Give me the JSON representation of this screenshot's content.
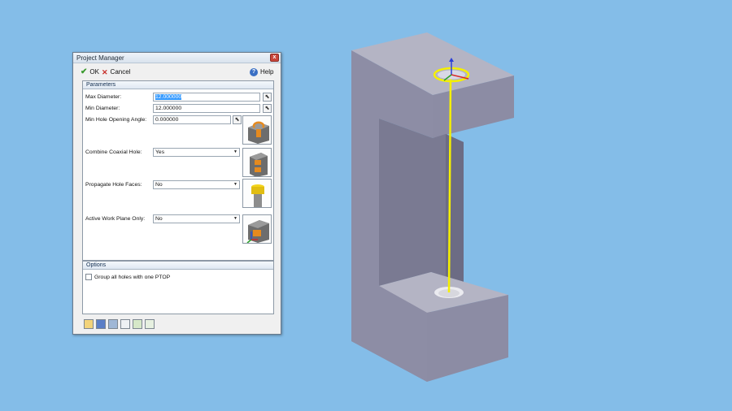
{
  "window": {
    "title": "Project Manager",
    "close_glyph": "x"
  },
  "toolbar": {
    "ok_label": "OK",
    "cancel_label": "Cancel",
    "help_label": "Help"
  },
  "parameters": {
    "header": "Parameters",
    "max_diameter": {
      "label": "Max Diameter:",
      "value": "12.000000"
    },
    "min_diameter": {
      "label": "Min Diameter:",
      "value": "12.000000"
    },
    "min_hole_opening_angle": {
      "label": "Min Hole Opening Angle:",
      "value": "0.000000"
    },
    "combine_coaxial_hole": {
      "label": "Combine Coaxial Hole:",
      "value": "Yes"
    },
    "propagate_hole_faces": {
      "label": "Propagate Hole Faces:",
      "value": "No"
    },
    "active_work_plane_only": {
      "label": "Active Work Plane Only:",
      "value": "No"
    }
  },
  "options": {
    "header": "Options",
    "group_all_holes": "Group all holes with one PTOP"
  },
  "icons": {
    "ok": "check-icon",
    "cancel": "x-icon",
    "help": "help-icon",
    "pick": "pick-icon",
    "preview_angle": "hole-opening-angle-preview",
    "preview_coaxial": "coaxial-hole-preview",
    "preview_propagate": "propagate-faces-preview",
    "preview_workplane": "work-plane-preview"
  },
  "colors": {
    "background": "#84bde8",
    "part_face": "#8c8ca4",
    "selection": "#3399ff",
    "axis_line": "#f5f000"
  }
}
